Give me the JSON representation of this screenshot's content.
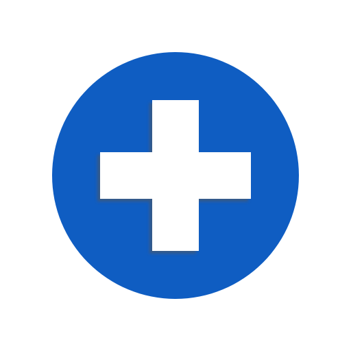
{
  "icon": {
    "name": "plus-icon",
    "circle_color": "#0f5dc2",
    "cross_color": "#ffffff",
    "shadow_color": "#555555"
  }
}
